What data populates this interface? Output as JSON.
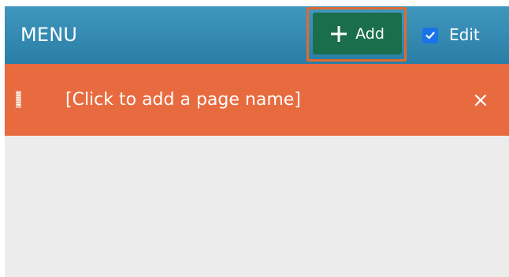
{
  "header": {
    "title": "MENU",
    "add_label": "Add",
    "edit_label": "Edit",
    "edit_checked": true,
    "add_icon": "plus-icon",
    "edit_icon": "checkmark-icon"
  },
  "pages": [
    {
      "name": "[Click to add a page name]",
      "handle_icon": "drag-handle-icon",
      "remove_icon": "close-icon"
    }
  ],
  "colors": {
    "header": "#2f88b0",
    "add_button": "#1b6e4b",
    "focus_ring": "#e06a2e",
    "page_row": "#e86a3f",
    "checkbox": "#1a73e8",
    "background": "#ececec"
  }
}
